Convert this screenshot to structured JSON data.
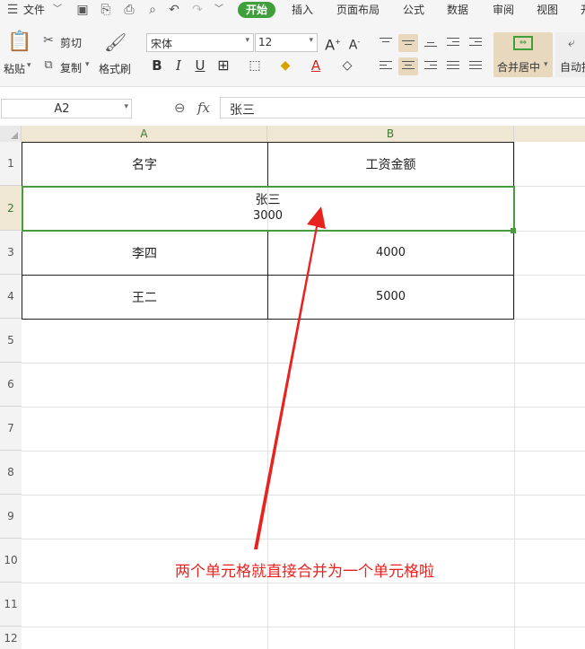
{
  "menubar": {
    "file_label": "文件",
    "tabs": [
      "开始",
      "插入",
      "页面布局",
      "公式",
      "数据",
      "审阅",
      "视图",
      "开"
    ]
  },
  "ribbon": {
    "paste_label": "粘贴",
    "cut_label": "剪切",
    "copy_label": "复制",
    "format_painter_label": "格式刷",
    "font_name": "宋体",
    "font_size": "12",
    "merge_center_label": "合并居中",
    "auto_wrap_label": "自动换"
  },
  "formula_bar": {
    "name_box": "A2",
    "fx_label": "fx",
    "content": "张三"
  },
  "sheet": {
    "columns": [
      "A",
      "B"
    ],
    "rows": [
      "1",
      "2",
      "3",
      "4",
      "5",
      "6",
      "7",
      "8",
      "9",
      "10",
      "11",
      "12"
    ],
    "header": {
      "name": "名字",
      "salary": "工资金额"
    },
    "merged_cell_lines": [
      "张三",
      "3000"
    ],
    "data_rows": [
      {
        "name": "李四",
        "salary": "4000"
      },
      {
        "name": "王二",
        "salary": "5000"
      }
    ]
  },
  "annotation": {
    "text": "两个单元格就直接合并为一个单元格啦",
    "color": "#e8231f"
  },
  "colors": {
    "accent": "#3f9f3a",
    "selection_border": "#4a9a3f"
  }
}
